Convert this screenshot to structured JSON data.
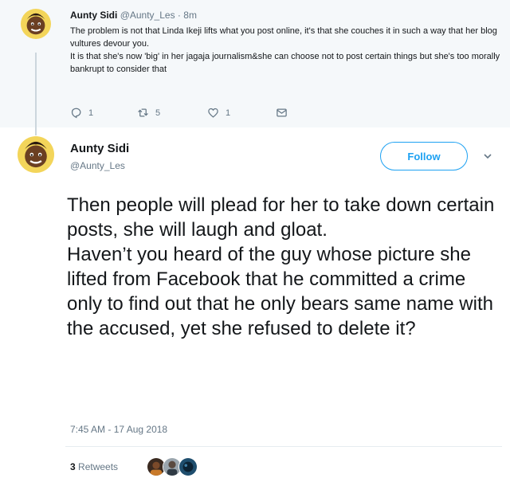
{
  "parent_tweet": {
    "author_name": "Aunty Sidi",
    "author_handle": "@Aunty_Les",
    "separator": "·",
    "time": "8m",
    "text_line1": "The problem is not that Linda Ikeji lifts what you post online, it's that she couches it in such a way that her blog vultures devour you.",
    "text_line2": "It is that she's now 'big' in her jagaja journalism&she can choose not to post certain things but she's too morally bankrupt to consider that",
    "reply_count": "1",
    "retweet_count": "5",
    "like_count": "1",
    "icons": [
      "reply-icon",
      "retweet-icon",
      "heart-icon",
      "envelope-icon"
    ]
  },
  "main_tweet": {
    "author_name": "Aunty Sidi",
    "author_handle": "@Aunty_Les",
    "follow_label": "Follow",
    "text_para1": "Then people will plead for her to take down certain posts, she will laugh and gloat.",
    "text_para2": "Haven’t you heard of the guy whose picture she lifted from Facebook that he committed a crime only to find out that he only bears same name with the accused, yet she refused to delete it?",
    "timestamp": "7:45 AM - 17 Aug 2018",
    "retweet_count": "3",
    "retweet_label": "Retweets"
  },
  "colors": {
    "accent": "#1da1f2",
    "secondary_text": "#657786",
    "parent_background": "#f5f8fa"
  }
}
